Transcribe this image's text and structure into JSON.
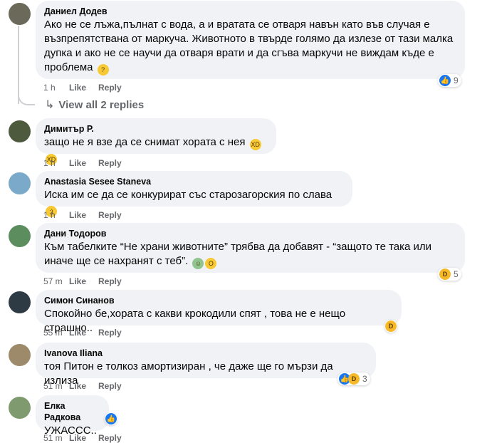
{
  "comments": [
    {
      "author": "Даниел Додев",
      "text": "Ако не се лъжа,пълнат с вода, а и вратата се отваря навън като във случая е възпрепятствана от маркуча. Животното в твърде голямо да излезе от тази малка дупка и ако не се научи да отваря врати и да сгъва маркучи не виждам къде е проблема",
      "time": "1 h",
      "like": "Like",
      "reply": "Reply",
      "reaction_count": "9",
      "avatar_color": "#6b6a5a"
    },
    {
      "author": "Димитър Р.",
      "text": "защо не я взе да се снимат хората с нея",
      "time": "1 h",
      "like": "Like",
      "reply": "Reply",
      "avatar_color": "#4e5a3d"
    },
    {
      "author": "Anastasia Sesee Staneva",
      "text": "Иска им се да се конкурират със старозагорския по слава",
      "time": "1 h",
      "like": "Like",
      "reply": "Reply",
      "avatar_color": "#7aa9c9"
    },
    {
      "author": "Дани Тодоров",
      "text": "Към табелките “Не храни животните” трябва да добавят - “защото те така или иначе ще се нахранят с теб”.",
      "time": "57 m",
      "like": "Like",
      "reply": "Reply",
      "reaction_count": "5",
      "avatar_color": "#5b8d5f"
    },
    {
      "author": "Симон Синанов",
      "text": "Спокойно бе,хората с какви крокодили спят , това не е нещо страшно..",
      "time": "55 m",
      "like": "Like",
      "reply": "Reply",
      "avatar_color": "#2e3b44"
    },
    {
      "author": "Ivanova Iliana",
      "text": "тоя Питон е толкоз амортизиран , че даже ще го мързи да излиза",
      "time": "51 m",
      "like": "Like",
      "reply": "Reply",
      "reaction_count": "3",
      "avatar_color": "#9c8a6a"
    },
    {
      "author": "Елка Радкова",
      "text": "УЖАССС..",
      "time": "51 m",
      "like": "Like",
      "reply": "Reply",
      "avatar_color": "#7f9a6e"
    }
  ],
  "view_replies": "View all 2 replies",
  "colors": {
    "bubble": "#f0f2f5",
    "meta": "#65676b",
    "like_blue": "#1877f2",
    "haha_yellow": "#f7b928"
  }
}
